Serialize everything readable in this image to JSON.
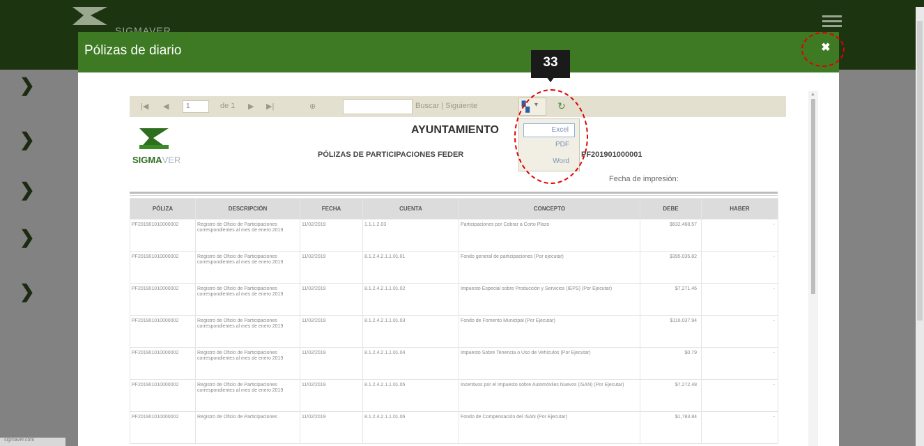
{
  "app": {
    "brand": "SIGMAVER",
    "sidebar_arrows": [
      "❯",
      "❯",
      "❯",
      "❯",
      "❯"
    ],
    "bottom_tab": "sigmaver.com"
  },
  "modal": {
    "title": "Pólizas de diario",
    "close_label": "✖"
  },
  "badge": "33",
  "toolbar": {
    "first": "|◀",
    "prev": "◀",
    "page_value": "1",
    "of_label": "de 1",
    "next": "▶",
    "last": "▶|",
    "zoom_icon": "⊕",
    "search_label": "Buscar | Siguiente",
    "export_icon": "floppy-icon",
    "refresh_icon": "refresh-icon"
  },
  "export_menu": {
    "options": [
      "Excel",
      "PDF",
      "Word"
    ],
    "selected": "Excel"
  },
  "report": {
    "logo_text_bold": "SIGMA",
    "logo_text_light": "VER",
    "title": "AYUNTAMIENTO",
    "subtitle": "PÓLIZAS DE PARTICIPACIONES FEDER",
    "folio": "PF201901000001",
    "date_label": "Fecha de impresión:",
    "columns": [
      "PÓLIZA",
      "DESCRIPCIÓN",
      "FECHA",
      "CUENTA",
      "CONCEPTO",
      "DEBE",
      "HABER"
    ],
    "rows": [
      {
        "poliza": "PF201901010000002",
        "descripcion": "Registro de Oficio de Participaciones correspondientes al mes de enero 2019",
        "fecha": "11/02/2019",
        "cuenta": "1.1.1.2.03",
        "concepto": "Participaciones por Cobrar a Corto Plazo",
        "debe": "$632,468.57",
        "haber": "-"
      },
      {
        "poliza": "PF201901010000002",
        "descripcion": "Registro de Oficio de Participaciones correspondientes al mes de enero 2019",
        "fecha": "11/02/2019",
        "cuenta": "8.1.2.4.2.1.1.01.01",
        "concepto": "Fondo general de participaciones (Por ejecutar)",
        "debe": "$395,035.82",
        "haber": "-"
      },
      {
        "poliza": "PF201901010000002",
        "descripcion": "Registro de Oficio de Participaciones correspondientes al mes de enero 2019",
        "fecha": "11/02/2019",
        "cuenta": "8.1.2.4.2.1.1.01.02",
        "concepto": "Impuesto Especial sobre Producción y Servicios (IEPS) (Por Ejecutar)",
        "debe": "$7,271.46",
        "haber": "-"
      },
      {
        "poliza": "PF201901010000002",
        "descripcion": "Registro de Oficio de Participaciones correspondientes al mes de enero 2019",
        "fecha": "11/02/2019",
        "cuenta": "8.1.2.4.2.1.1.01.03",
        "concepto": "Fondo de Fomento Municipal (Por Ejecutar)",
        "debe": "$116,037.94",
        "haber": "-"
      },
      {
        "poliza": "PF201901010000002",
        "descripcion": "Registro de Oficio de Participaciones correspondientes al mes de enero 2019",
        "fecha": "11/02/2019",
        "cuenta": "8.1.2.4.2.1.1.01.04",
        "concepto": "Impuesto Sobre Tenencia o Uso de Vehículos (Por Ejecutar)",
        "debe": "$0.79",
        "haber": "-"
      },
      {
        "poliza": "PF201901010000002",
        "descripcion": "Registro de Oficio de Participaciones correspondientes al mes de enero 2019",
        "fecha": "11/02/2019",
        "cuenta": "8.1.2.4.2.1.1.01.05",
        "concepto": "Incentivos por el Impuesto sobre Automóviles Nuevos (ISAN) (Por Ejecutar)",
        "debe": "$7,272.48",
        "haber": "-"
      },
      {
        "poliza": "PF201901010000002",
        "descripcion": "Registro de Oficio de Participaciones",
        "fecha": "11/02/2019",
        "cuenta": "8.1.2.4.2.1.1.01.06",
        "concepto": "Fondo de Compensación del ISAN (Por Ejecutar)",
        "debe": "$1,783.84",
        "haber": "-"
      }
    ]
  },
  "colors": {
    "header_dark": "#1c3510",
    "modal_header": "#3e7a23",
    "highlight_circle": "#e00000"
  }
}
